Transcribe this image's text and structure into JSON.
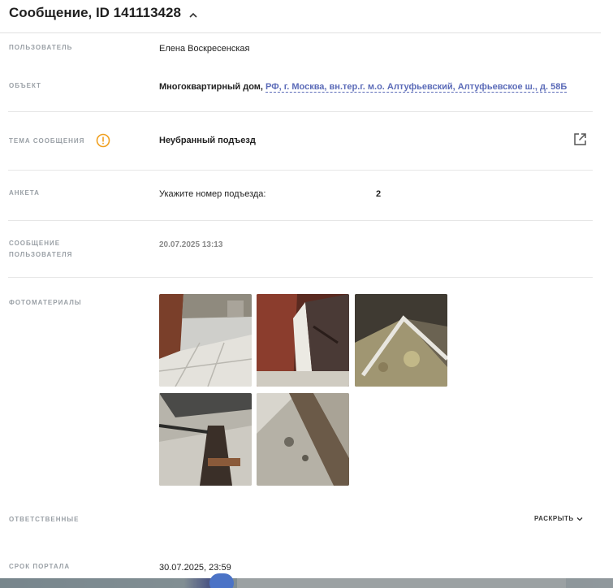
{
  "header": {
    "title": "Сообщение, ID 141113428"
  },
  "fields": {
    "user": {
      "label": "ПОЛЬЗОВАТЕЛЬ",
      "value": "Елена Воскресенская"
    },
    "object": {
      "label": "ОБЪЕКТ",
      "type": "Многоквартирный дом,",
      "address": "РФ, г. Москва, вн.тер.г. м.о. Алтуфьевский, Алтуфьевское ш., д. 58Б"
    },
    "topic": {
      "label": "ТЕМА СООБЩЕНИЯ",
      "value": "Неубранный подъезд"
    },
    "form": {
      "label": "АНКЕТА",
      "question": "Укажите номер подъезда:",
      "answer": "2"
    },
    "user_message": {
      "label_line1": "СООБЩЕНИЕ",
      "label_line2": "ПОЛЬЗОВАТЕЛЯ",
      "value": "20.07.2025 13:13"
    },
    "photos": {
      "label": "ФОТОМАТЕРИАЛЫ",
      "count": 5
    },
    "responsible": {
      "label": "ОТВЕТСТВЕННЫЕ",
      "action": "РАСКРЫТЬ"
    },
    "deadline": {
      "label": "СРОК ПОРТАЛА",
      "value": "30.07.2025, 23:59"
    }
  },
  "colors": {
    "link": "#5b6bb8",
    "warning": "#f0a020",
    "label": "#9aa0a6"
  },
  "icons": {
    "collapse": "chevron-up-icon",
    "warning": "warning-circle-icon",
    "open_external": "open-in-new-icon",
    "expand": "chevron-down-icon"
  }
}
